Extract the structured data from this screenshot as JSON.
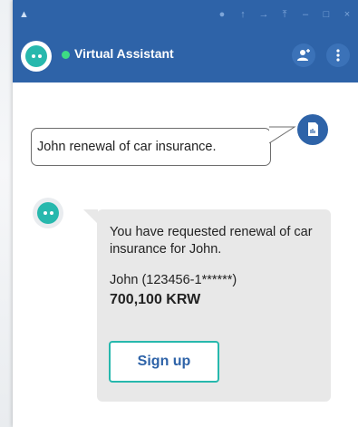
{
  "header": {
    "title": "Virtual Assistant",
    "online_color": "#3ddc84",
    "brand_color": "#2e63a8",
    "accent_color": "#27b8ad",
    "icons": [
      "home-icon",
      "pin-icon",
      "up-icon",
      "arrow-right-icon",
      "top-icon",
      "minimize-icon",
      "maximize-icon",
      "close-icon",
      "add-user-icon",
      "more-vert-icon"
    ]
  },
  "messages": {
    "user": {
      "text": "John renewal of car insurance."
    },
    "bot": {
      "text": "You have requested renewal of car insurance for John.",
      "identity": "John (123456-1******)",
      "amount": "700,100 KRW",
      "button_label": "Sign up"
    }
  }
}
